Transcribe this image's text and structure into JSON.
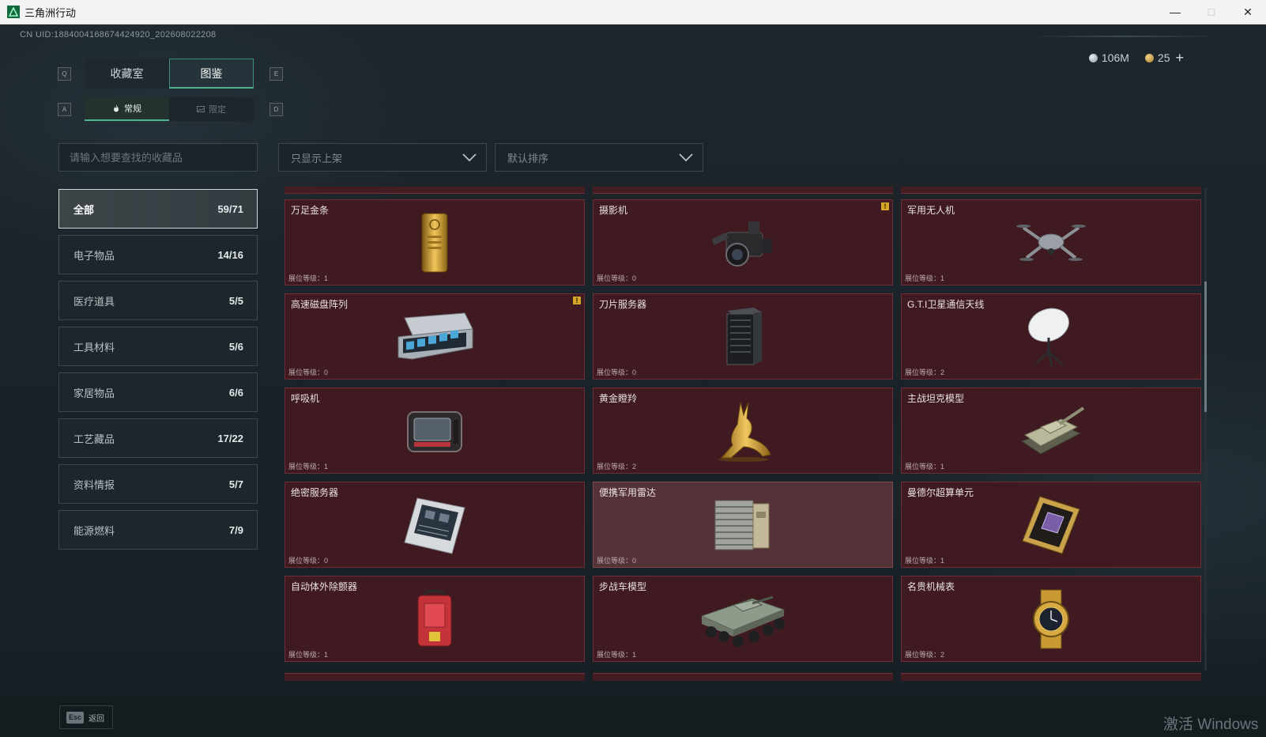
{
  "window": {
    "title": "三角洲行动"
  },
  "uid_text": "CN UID:18840041686744249​20_202608022208",
  "currency": {
    "silver": "106M",
    "gold": "25",
    "plus": "+"
  },
  "keys": {
    "q": "Q",
    "e": "E",
    "a": "A",
    "d": "D"
  },
  "main_tabs": [
    {
      "label": "收藏室",
      "active": false
    },
    {
      "label": "图鉴",
      "active": true
    }
  ],
  "sub_tabs": [
    {
      "label": "常规",
      "active": true
    },
    {
      "label": "限定",
      "active": false
    }
  ],
  "search": {
    "placeholder": "请输入想要查找的收藏品"
  },
  "filters": {
    "shelf": "只显示上架",
    "sort": "默认排序"
  },
  "categories": [
    {
      "label": "全部",
      "count": "59/71",
      "active": true
    },
    {
      "label": "电子物品",
      "count": "14/16"
    },
    {
      "label": "医疗道具",
      "count": "5/5"
    },
    {
      "label": "工具材料",
      "count": "5/6"
    },
    {
      "label": "家居物品",
      "count": "6/6"
    },
    {
      "label": "工艺藏品",
      "count": "17/22"
    },
    {
      "label": "资料情报",
      "count": "5/7"
    },
    {
      "label": "能源燃料",
      "count": "7/9"
    }
  ],
  "items": [
    {
      "name": "万足金条",
      "level": "展位等级：1",
      "icon": "gold-bar-icon"
    },
    {
      "name": "摄影机",
      "level": "展位等级：0",
      "icon": "camera-icon",
      "alert": "!"
    },
    {
      "name": "军用无人机",
      "level": "展位等级：1",
      "icon": "drone-icon"
    },
    {
      "name": "高速磁盘阵列",
      "level": "展位等级：0",
      "icon": "disk-array-icon",
      "alert": "!"
    },
    {
      "name": "刀片服务器",
      "level": "展位等级：0",
      "icon": "blade-server-icon"
    },
    {
      "name": "G.T.I卫星通信天线",
      "level": "展位等级：2",
      "icon": "satellite-dish-icon"
    },
    {
      "name": "呼吸机",
      "level": "展位等级：1",
      "icon": "ventilator-icon"
    },
    {
      "name": "黄金瞪羚",
      "level": "展位等级：2",
      "icon": "golden-gazelle-icon"
    },
    {
      "name": "主战坦克模型",
      "level": "展位等级：1",
      "icon": "tank-model-icon"
    },
    {
      "name": "绝密服务器",
      "level": "展位等级：0",
      "icon": "secret-server-icon"
    },
    {
      "name": "便携军用雷达",
      "level": "展位等级：0",
      "icon": "portable-radar-icon",
      "hover": true
    },
    {
      "name": "曼德尔超算单元",
      "level": "展位等级：1",
      "icon": "supercomputer-unit-icon"
    },
    {
      "name": "自动体外除颤器",
      "level": "展位等级：1",
      "icon": "defibrillator-icon"
    },
    {
      "name": "步战车模型",
      "level": "展位等级：1",
      "icon": "ifv-model-icon"
    },
    {
      "name": "名贵机械表",
      "level": "展位等级：2",
      "icon": "luxury-watch-icon"
    }
  ],
  "bottom": {
    "esc_key": "Esc",
    "back_label": "返回"
  },
  "watermark": "激活 Windows",
  "colors": {
    "accent": "#4fb38e",
    "card_bg": "#3f1b21",
    "card_border": "#6b3037"
  }
}
